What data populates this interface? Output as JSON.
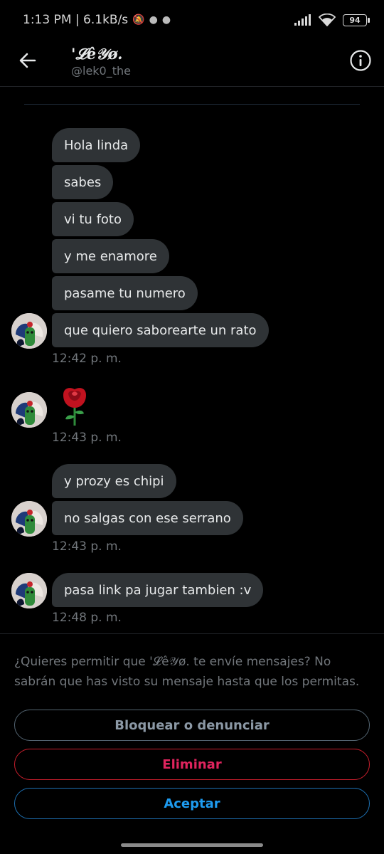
{
  "status_bar": {
    "time_speed": "1:13 PM | 6.1kB/s",
    "battery": "94",
    "icons": [
      "mute-icon",
      "app-notification-icon",
      "app-notification-icon",
      "signal-icon",
      "wifi-icon",
      "battery-icon"
    ]
  },
  "header": {
    "name": "'𝓛ê𝒴ø.",
    "handle": "@lek0_the",
    "back_icon": "arrow-left-icon",
    "info_icon": "info-icon"
  },
  "messages": {
    "group1": [
      "Hola linda",
      "sabes",
      "vi tu foto",
      "y me enamore",
      "pasame tu numero",
      "que quiero saborearte un rato"
    ],
    "ts1": "12:42 p. m.",
    "rose": "rose-emoji",
    "ts2": "12:43 p. m.",
    "group3": [
      "y prozy es chipi",
      "no salgas con ese serrano"
    ],
    "ts3": "12:43 p. m.",
    "group4": [
      "pasa link pa jugar tambien :v"
    ],
    "ts4": "12:48 p. m."
  },
  "request": {
    "prompt": "¿Quieres permitir que '𝓛ê𝒴ø. te envíe mensajes? No sabrán que has visto su mensaje hasta que los permitas.",
    "block_label": "Bloquear o denunciar",
    "delete_label": "Eliminar",
    "accept_label": "Aceptar"
  },
  "colors": {
    "background": "#000000",
    "bubble": "#2f3336",
    "muted_text": "#71767b",
    "danger": "#e0245e",
    "accent": "#1d9bf0"
  }
}
